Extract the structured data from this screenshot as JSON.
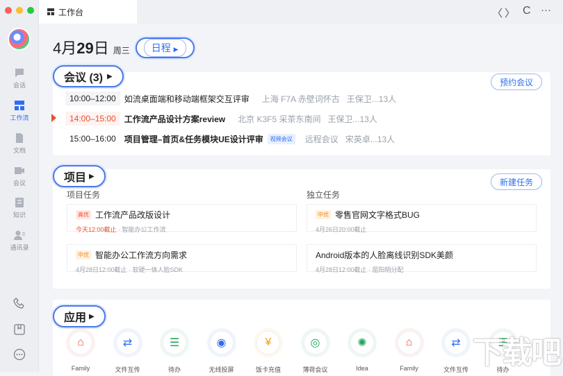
{
  "window": {
    "tab_title": "工作台",
    "traffic_colors": [
      "#fe5f57",
      "#febc2e",
      "#28c840"
    ]
  },
  "sidebar": {
    "items": [
      {
        "label": "会话",
        "icon": "chat-icon"
      },
      {
        "label": "工作流",
        "icon": "workflow-icon",
        "active": true
      },
      {
        "label": "文档",
        "icon": "document-icon"
      },
      {
        "label": "会议",
        "icon": "video-icon"
      },
      {
        "label": "知识",
        "icon": "knowledge-icon"
      },
      {
        "label": "通讯录",
        "icon": "contacts-icon"
      }
    ],
    "bottom_icons": [
      "phone-icon",
      "bookmark-icon",
      "more-icon"
    ]
  },
  "topbar": {
    "back": "〈",
    "forward": "〉",
    "refresh": "C",
    "more": "···"
  },
  "header": {
    "month_day_pre": "4月",
    "day": "29",
    "day_suffix": "日",
    "weekday": "周三",
    "schedule_label": "日程"
  },
  "meetings": {
    "title": "会议 (3)",
    "book_button": "预约会议",
    "items": [
      {
        "time": "10:00–12:00",
        "title": "如流桌面端和移动端框架交互评审",
        "location": "上海 F7A 赤壁词怀古",
        "people": "王保卫...13人",
        "tag": ""
      },
      {
        "time": "14:00–15:00",
        "title": "工作流产品设计方案review",
        "location": "北京 K3F5 采茶东南间",
        "people": "王保卫...13人",
        "tag": "",
        "current": true
      },
      {
        "time": "15:00–16:00",
        "title": "项目管理–首页&任务模块UE设计评审",
        "location": "远程会议",
        "people": "宋英卓...13人",
        "tag": "视频会议"
      }
    ]
  },
  "projects": {
    "title": "项目",
    "new_button": "新建任务",
    "col_left": "项目任务",
    "col_right": "独立任务",
    "tasks": [
      {
        "priority": "高优",
        "title": "工作流产品改版设计",
        "due": "今天12:00截止",
        "meta": " · 智能办公工作流"
      },
      {
        "priority": "中优",
        "title": "零售官网文字格式BUG",
        "due": "",
        "meta": "4月26日20:00截止"
      },
      {
        "priority": "中优",
        "title": "智能办公工作流方向需求",
        "due": "",
        "meta": "4月28日12:00截止 · 软硬一体人脸SDK"
      },
      {
        "priority": "",
        "title": "Android版本的人脸离线识别SDK美颜",
        "due": "",
        "meta": "4月28日12:00截止 · 屈阳明分配"
      }
    ]
  },
  "apps": {
    "title": "应用",
    "items": [
      {
        "label": "Family",
        "icon": "home-icon",
        "color": "#e8502e"
      },
      {
        "label": "文件互传",
        "icon": "transfer-icon",
        "color": "#2f6ef0"
      },
      {
        "label": "待办",
        "icon": "todo-icon",
        "color": "#22a45d"
      },
      {
        "label": "无线投屏",
        "icon": "wifi-icon",
        "color": "#2f6ef0"
      },
      {
        "label": "饭卡充值",
        "icon": "yen-icon",
        "color": "#f0a020"
      },
      {
        "label": "薄荷会议",
        "icon": "chat-bubble-icon",
        "color": "#22a45d"
      },
      {
        "label": "Idea",
        "icon": "bulb-icon",
        "color": "#22a45d"
      },
      {
        "label": "Family",
        "icon": "home-icon",
        "color": "#e8502e"
      },
      {
        "label": "文件互传",
        "icon": "transfer-icon",
        "color": "#2f6ef0"
      },
      {
        "label": "待办",
        "icon": "todo-icon",
        "color": "#22a45d"
      }
    ]
  },
  "watermark": "下载吧"
}
